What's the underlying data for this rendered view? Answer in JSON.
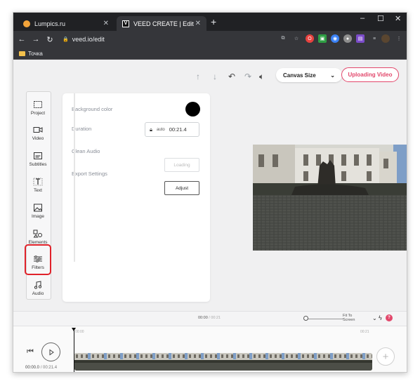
{
  "browser": {
    "tabs": [
      {
        "title": "Lumpics.ru",
        "active": false
      },
      {
        "title": "VEED CREATE | Edit",
        "active": true
      }
    ],
    "url": "veed.io/edit",
    "bookmark": "Точка"
  },
  "topbar": {
    "canvas_size_label": "Canvas Size",
    "upload_label": "Uploading Video",
    "accent_color": "#e2476b"
  },
  "sidebar": {
    "items": [
      {
        "label": "Project",
        "icon": "project-icon"
      },
      {
        "label": "Video",
        "icon": "video-icon"
      },
      {
        "label": "Subtitles",
        "icon": "subtitles-icon"
      },
      {
        "label": "Text",
        "icon": "text-icon"
      },
      {
        "label": "Image",
        "icon": "image-icon"
      },
      {
        "label": "Elements",
        "icon": "elements-icon"
      },
      {
        "label": "Filters",
        "icon": "filters-icon",
        "highlighted": true
      },
      {
        "label": "Audio",
        "icon": "audio-icon"
      }
    ]
  },
  "panel": {
    "background_color_label": "Background color",
    "background_color_value": "#000000",
    "duration_label": "Duration",
    "duration_auto": "auto",
    "duration_value": "00:21.4",
    "clean_audio_label": "Clean Audio",
    "clean_audio_button": "Loading",
    "export_label": "Export Settings",
    "export_button": "Adjust"
  },
  "timeline": {
    "time_current": "00:00",
    "time_total": "/ 00:21",
    "fit_label": "Fit To Screen",
    "ruler_start": "00:00",
    "ruler_end": "00:21",
    "playback_current": "00:00.0",
    "playback_total": "/ 00:21.4",
    "badge_count": "?"
  }
}
